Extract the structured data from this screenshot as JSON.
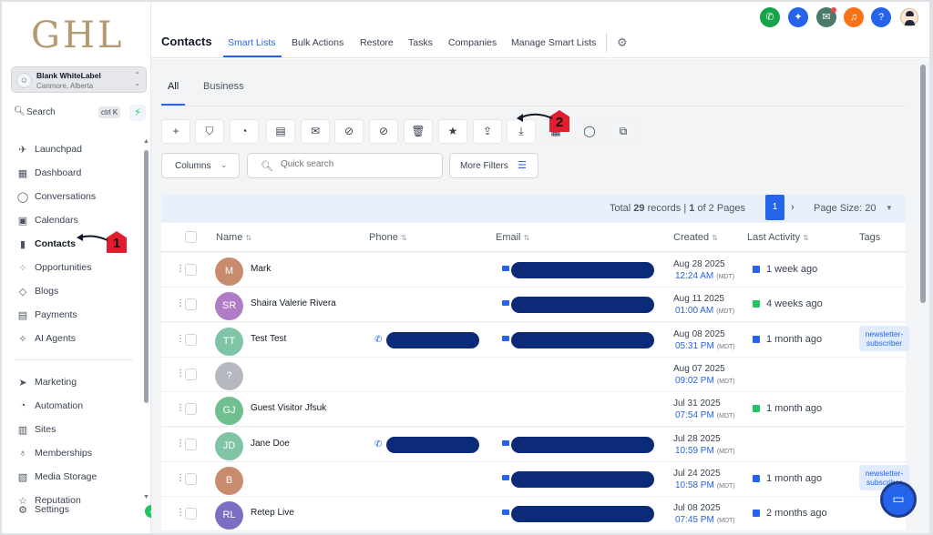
{
  "brand": {
    "logo_text": "GHL"
  },
  "account": {
    "name": "Blank WhiteLabel",
    "location": "Canmore, Alberta"
  },
  "sidebar": {
    "search_label": "Search",
    "search_shortcut": "ctrl K",
    "items": [
      {
        "label": "Launchpad",
        "icon": "rocket-icon"
      },
      {
        "label": "Dashboard",
        "icon": "grid-icon"
      },
      {
        "label": "Conversations",
        "icon": "chat-bubble-icon"
      },
      {
        "label": "Calendars",
        "icon": "calendar-icon"
      },
      {
        "label": "Contacts",
        "icon": "person-icon",
        "active": true
      },
      {
        "label": "Opportunities",
        "icon": "funnel-icon"
      },
      {
        "label": "Blogs",
        "icon": "cube-icon"
      },
      {
        "label": "Payments",
        "icon": "receipt-icon"
      },
      {
        "label": "AI Agents",
        "icon": "sparkle-icon"
      }
    ],
    "items2": [
      {
        "label": "Marketing",
        "icon": "send-icon"
      },
      {
        "label": "Automation",
        "icon": "automation-icon"
      },
      {
        "label": "Sites",
        "icon": "sites-icon"
      },
      {
        "label": "Memberships",
        "icon": "badge-icon"
      },
      {
        "label": "Media Storage",
        "icon": "image-icon"
      },
      {
        "label": "Reputation",
        "icon": "star-icon"
      },
      {
        "label": "Settings",
        "icon": "gear-icon"
      }
    ]
  },
  "header": {
    "title": "Contacts",
    "tabs": [
      "Smart Lists",
      "Bulk Actions",
      "Restore",
      "Tasks",
      "Companies",
      "Manage Smart Lists"
    ],
    "active_tab": "Smart Lists"
  },
  "subtabs": [
    "All",
    "Business"
  ],
  "controls": {
    "columns_label": "Columns",
    "search_placeholder": "Quick search",
    "more_filters_label": "More Filters"
  },
  "pagination": {
    "total_prefix": "Total ",
    "total_records": "29",
    "total_suffix": " records | ",
    "page_current_bold": "1",
    "page_of": " of 2 Pages",
    "current_page": "1",
    "page_size_label": "Page Size: 20"
  },
  "table": {
    "columns": [
      "Name",
      "Phone",
      "Email",
      "Created",
      "Last Activity",
      "Tags"
    ],
    "rows": [
      {
        "initials": "M",
        "color": "#c98b6e",
        "name": "Mark",
        "phone": false,
        "email": true,
        "date": "Aug 28 2025",
        "time": "12:24 AM",
        "tz": "(MDT)",
        "activity": "1 week ago",
        "activity_type": "email",
        "tag": ""
      },
      {
        "initials": "SR",
        "color": "#b07cc6",
        "name": "Shaira Valerie Rivera",
        "phone": false,
        "email": true,
        "date": "Aug 11 2025",
        "time": "01:00 AM",
        "tz": "(MDT)",
        "activity": "4 weeks ago",
        "activity_type": "sms",
        "tag": ""
      },
      {
        "initials": "TT",
        "color": "#7ec4a5",
        "name": "Test Test",
        "phone": true,
        "email": true,
        "date": "Aug 08 2025",
        "time": "05:31 PM",
        "tz": "(MDT)",
        "activity": "1 month ago",
        "activity_type": "email",
        "tag": "newsletter-subscriber"
      },
      {
        "initials": "?",
        "color": "#b5b9bf",
        "name": "",
        "phone": false,
        "email": false,
        "date": "Aug 07 2025",
        "time": "09:02 PM",
        "tz": "(MDT)",
        "activity": "",
        "activity_type": "",
        "tag": ""
      },
      {
        "initials": "GJ",
        "color": "#6fbf8f",
        "name": "Guest Visitor Jfsuk",
        "phone": false,
        "email": false,
        "date": "Jul 31 2025",
        "time": "07:54 PM",
        "tz": "(MDT)",
        "activity": "1 month ago",
        "activity_type": "sms",
        "tag": ""
      },
      {
        "initials": "JD",
        "color": "#7ec4a5",
        "name": "Jane Doe",
        "phone": true,
        "email": true,
        "date": "Jul 28 2025",
        "time": "10:59 PM",
        "tz": "(MDT)",
        "activity": "",
        "activity_type": "",
        "tag": ""
      },
      {
        "initials": "B",
        "color": "#c98b6e",
        "name": "",
        "phone": false,
        "email": true,
        "date": "Jul 24 2025",
        "time": "10:58 PM",
        "tz": "(MDT)",
        "activity": "1 month ago",
        "activity_type": "email",
        "tag": "newsletter-subscriber"
      },
      {
        "initials": "RL",
        "color": "#7b6fc2",
        "name": "Retep Live",
        "phone": false,
        "email": true,
        "date": "Jul 08 2025",
        "time": "07:45 PM",
        "tz": "(MDT)",
        "activity": "2 months ago",
        "activity_type": "email",
        "tag": ""
      }
    ]
  },
  "annotations": [
    "1",
    "2"
  ],
  "colors": {
    "accent": "#2563eb",
    "redaction": "#0b2a78",
    "marker": "#e11d2e"
  }
}
